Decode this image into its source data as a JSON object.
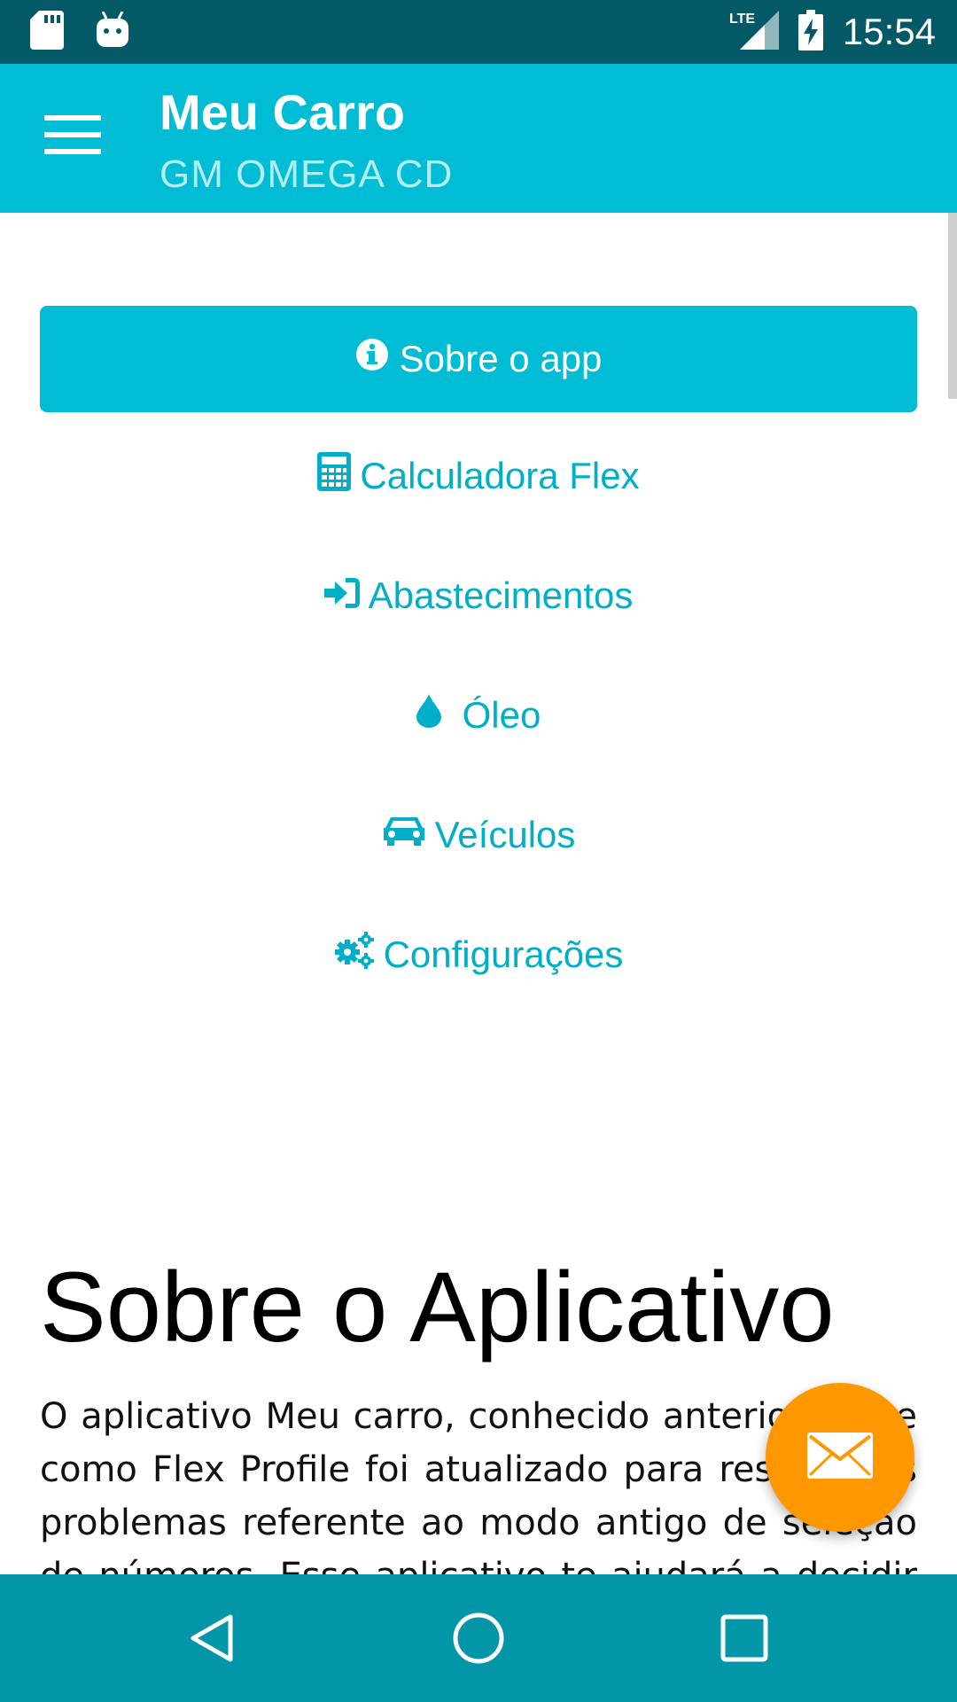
{
  "status_bar": {
    "time": "15:54",
    "network": "LTE",
    "icons": [
      "sd-card-icon",
      "android-icon",
      "lte-signal-icon",
      "battery-charging-icon"
    ]
  },
  "app_bar": {
    "title": "Meu Carro",
    "subtitle": "GM OMEGA CD",
    "menu_icon": "hamburger-menu-icon"
  },
  "main": {
    "primary_button": {
      "label": "Sobre o app",
      "icon": "info-circle-icon"
    },
    "links": [
      {
        "label": "Calculadora Flex",
        "icon": "calculator-icon"
      },
      {
        "label": "Abastecimentos",
        "icon": "sign-in-icon"
      },
      {
        "label": "Óleo",
        "icon": "drop-icon"
      },
      {
        "label": "Veículos",
        "icon": "car-icon"
      },
      {
        "label": "Configurações",
        "icon": "gears-icon"
      }
    ],
    "about": {
      "heading": "Sobre o Aplicativo",
      "text": "O aplicativo Meu carro, conhecido anteriormente como Flex Profile foi atualizado para resolver os problemas referente ao modo antigo de seleção de números. Esse aplicativo te ajudará a decidir qual o"
    }
  },
  "fab": {
    "icon": "envelope-icon"
  },
  "nav_bar": {
    "buttons": [
      "back-icon",
      "home-icon",
      "recents-icon"
    ]
  },
  "colors": {
    "status_bar": "#035a66",
    "primary": "#00bcd4",
    "link": "#00afc7",
    "fab": "#ff9800",
    "nav_bar": "#0296a8"
  }
}
